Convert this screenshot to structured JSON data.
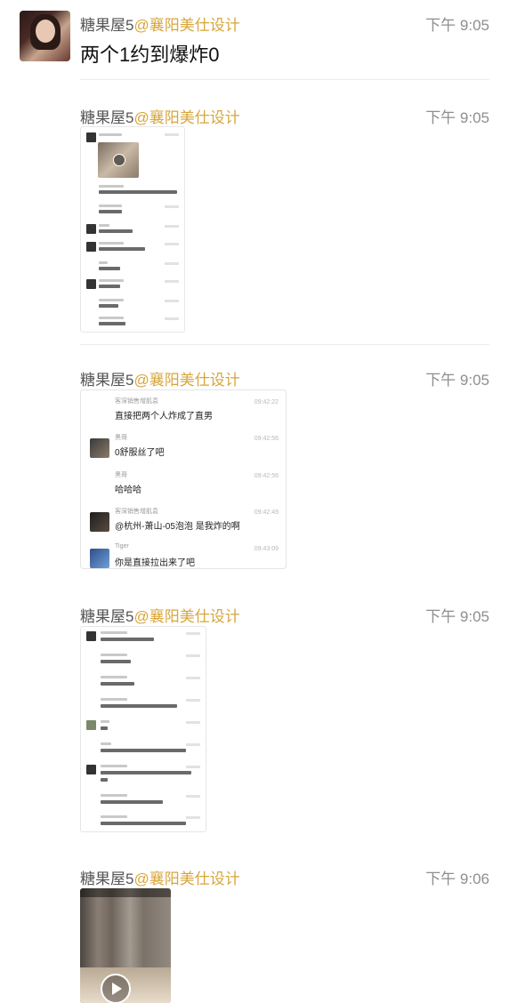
{
  "messages": [
    {
      "sender": "糖果屋5",
      "org": "@襄阳美仕设计",
      "time": "下午 9:05",
      "text": "两个1约到爆炸0"
    },
    {
      "sender": "糖果屋5",
      "org": "@襄阳美仕设计",
      "time": "下午 9:05"
    },
    {
      "sender": "糖果屋5",
      "org": "@襄阳美仕设计",
      "time": "下午 9:05"
    },
    {
      "sender": "糖果屋5",
      "org": "@襄阳美仕设计",
      "time": "下午 9:05"
    },
    {
      "sender": "糖果屋5",
      "org": "@襄阳美仕设计",
      "time": "下午 9:06"
    }
  ],
  "screenshot_chat": [
    {
      "name": "客深销售增肌袁",
      "time": "09:42:22",
      "text": "直接把两个人炸成了直男"
    },
    {
      "name": "黑哥",
      "time": "09:42:56",
      "text": "0舒服丝了吧"
    },
    {
      "name": "黑哥",
      "time": "09:42:56",
      "text": "哈哈哈"
    },
    {
      "name": "客深销售增肌袁",
      "time": "09:42:49",
      "text": "@杭州-萧山-05泡泡 是我炸的啊"
    },
    {
      "name": "Tiger",
      "time": "09:43:09",
      "text": "你是直接拉出来了吧"
    }
  ],
  "icons": {
    "play": "play-icon"
  }
}
